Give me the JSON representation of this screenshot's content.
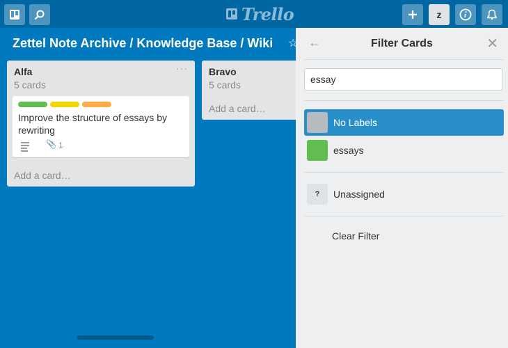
{
  "header": {
    "logo_text": "Trello",
    "member_initial": "z",
    "icons": [
      "boards-icon",
      "search-icon",
      "plus-icon",
      "info-icon",
      "bell-icon"
    ]
  },
  "board": {
    "title": "Zettel Note Archive / Knowledge Base / Wiki"
  },
  "lists": [
    {
      "name": "Alfa",
      "count": "5 cards",
      "menu": "···",
      "add_card": "Add a card…",
      "card": {
        "labels": [
          "#61bd4f",
          "#f2d600",
          "#ffab4a"
        ],
        "title": "Improve the structure of essays by rewriting",
        "attachments": "1"
      }
    },
    {
      "name": "Bravo",
      "count": "5 cards",
      "add_card": "Add a card…"
    }
  ],
  "filter_panel": {
    "title": "Filter Cards",
    "search_value": "essay",
    "options": [
      {
        "label": "No Labels",
        "color": "#b6bbbf",
        "selected": true
      },
      {
        "label": "essays",
        "color": "#61bd4f",
        "selected": false
      }
    ],
    "member": {
      "label": "Unassigned",
      "avatar": "?"
    },
    "clear": "Clear Filter"
  },
  "colors": {
    "board_bg": "#0079bf",
    "header_bg": "#0067a3",
    "selected": "#298fca"
  }
}
